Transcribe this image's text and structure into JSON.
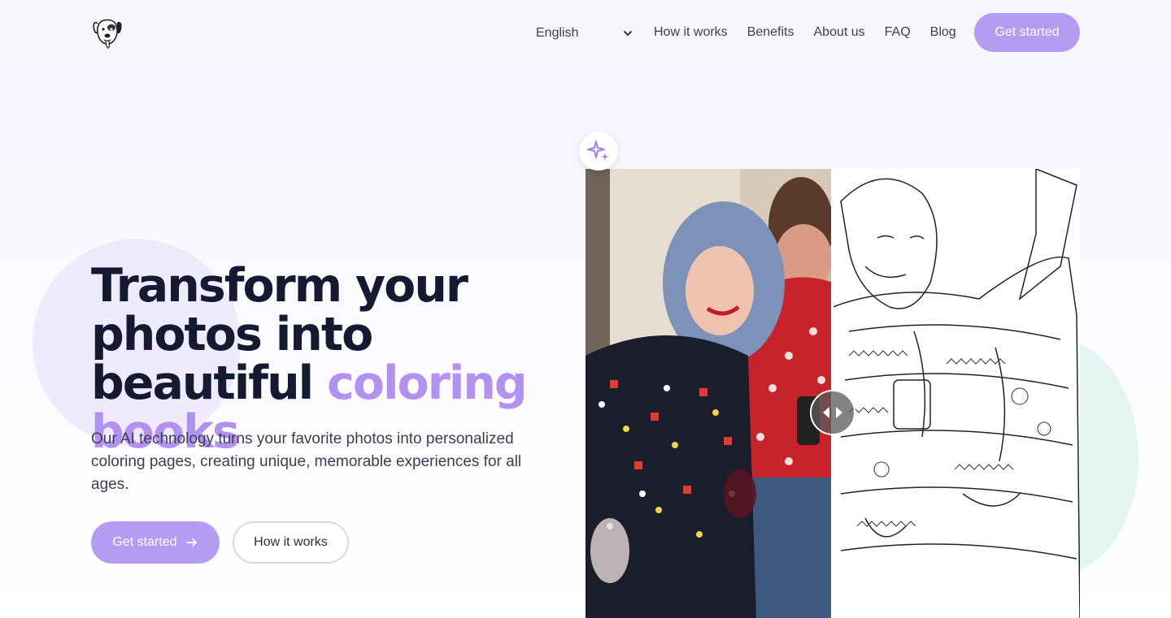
{
  "header": {
    "logo_icon": "dog-head-logo",
    "language": "English",
    "nav": [
      "How it works",
      "Benefits",
      "About us",
      "FAQ",
      "Blog"
    ],
    "cta": "Get started"
  },
  "hero": {
    "title_plain": "Transform your photos into beautiful ",
    "title_accent": "coloring books",
    "subtitle": "Our AI technology turns your favorite photos into personalized coloring pages, creating unique, memorable experiences for all ages.",
    "primary_button": "Get started",
    "secondary_button": "How it works"
  },
  "comparison": {
    "badge_icon": "sparkles-icon",
    "handle_icon": "left-right-arrows-icon",
    "split_fraction": 0.5
  },
  "colors": {
    "accent": "#b59cf2",
    "title_accent": "#b291f0",
    "dark_text": "#151a32",
    "mint_blob": "#e3f5f0",
    "purple_blob": "#efeafc"
  }
}
